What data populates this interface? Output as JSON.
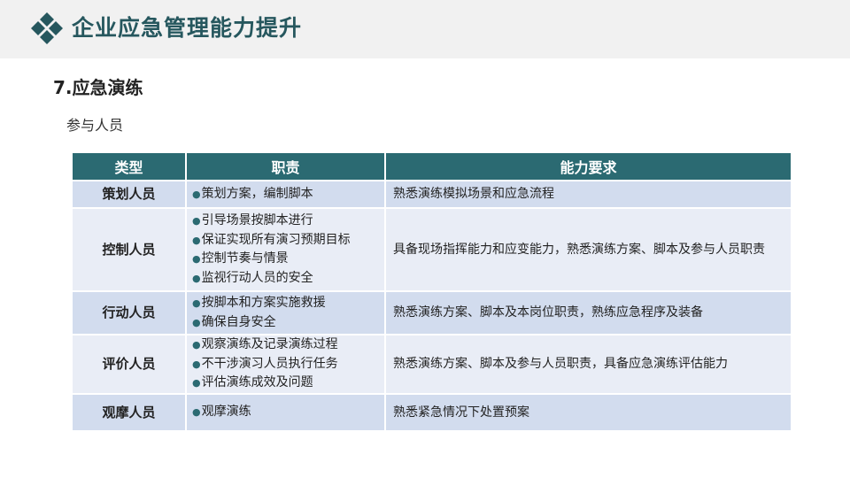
{
  "header": {
    "title": "企业应急管理能力提升",
    "logo_icon": "diamond-logo-icon",
    "colors": {
      "accent": "#26575e",
      "table_header": "#2b6a72",
      "row_dark": "#d2dcee",
      "row_light": "#e9edf6"
    }
  },
  "section": {
    "title": "7.应急演练",
    "subtitle": "参与人员"
  },
  "table": {
    "headers": [
      "类型",
      "职责",
      "能力要求"
    ],
    "rows": [
      {
        "role": "策划人员",
        "duties": [
          "策划方案，编制脚本"
        ],
        "requirement": "熟悉演练模拟场景和应急流程"
      },
      {
        "role": "控制人员",
        "duties": [
          "引导场景按脚本进行",
          "保证实现所有演习预期目标",
          "控制节奏与情景",
          "监视行动人员的安全"
        ],
        "requirement": "具备现场指挥能力和应变能力，熟悉演练方案、脚本及参与人员职责"
      },
      {
        "role": "行动人员",
        "duties": [
          "按脚本和方案实施救援",
          "确保自身安全"
        ],
        "requirement": "熟悉演练方案、脚本及本岗位职责，熟练应急程序及装备"
      },
      {
        "role": "评价人员",
        "duties": [
          "观察演练及记录演练过程",
          "不干涉演习人员执行任务",
          "评估演练成效及问题"
        ],
        "requirement": "熟悉演练方案、脚本及参与人员职责，具备应急演练评估能力"
      },
      {
        "role": "观摩人员",
        "duties": [
          "观摩演练"
        ],
        "requirement": "熟悉紧急情况下处置预案"
      }
    ]
  }
}
